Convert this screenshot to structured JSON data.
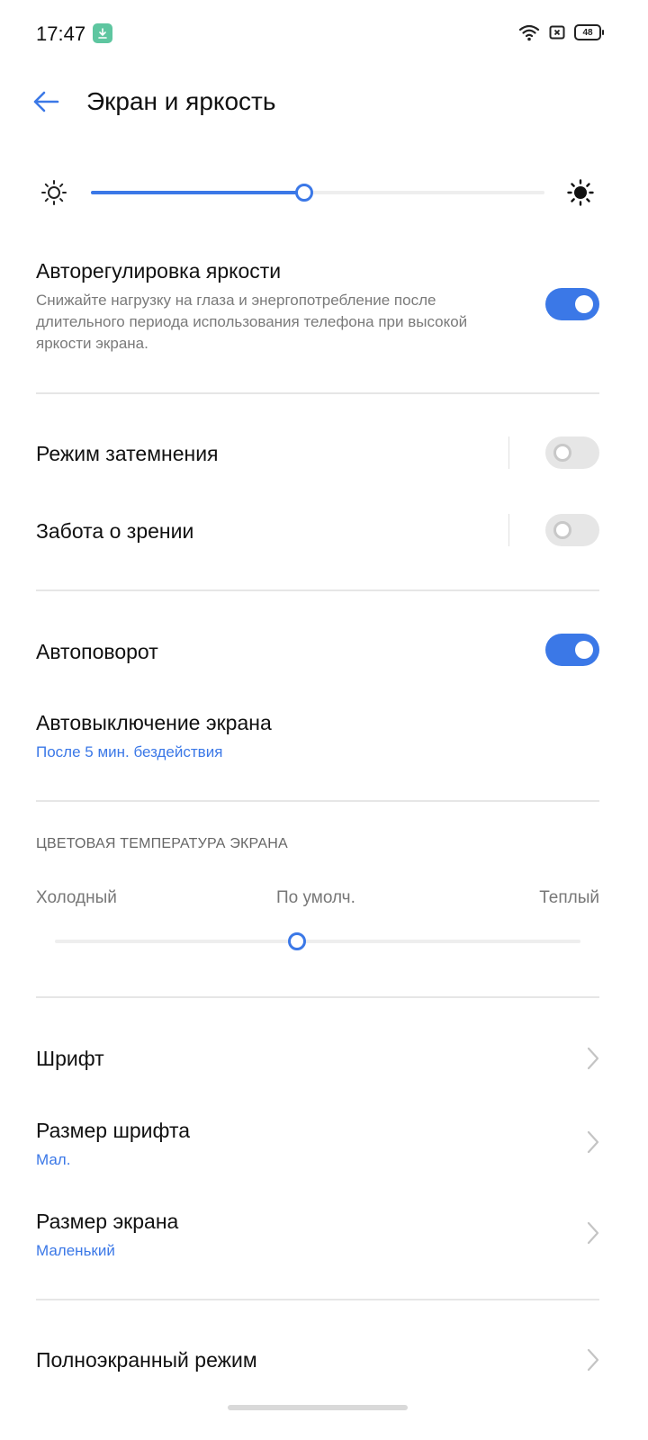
{
  "status_bar": {
    "time": "17:47",
    "battery_level": "48",
    "icons": [
      "download-icon",
      "wifi-icon",
      "screenshot-icon",
      "battery-icon"
    ]
  },
  "header": {
    "title": "Экран и яркость",
    "back_icon": "arrow-left-icon"
  },
  "brightness": {
    "level_percent": 47,
    "min_icon": "sun-outline-icon",
    "max_icon": "sun-filled-icon"
  },
  "auto_brightness": {
    "title": "Авторегулировка яркости",
    "description": "Снижайте нагрузку на глаза и энергопотребление после длительного периода использования телефона при высокой яркости экрана.",
    "enabled": true
  },
  "dark_mode": {
    "title": "Режим затемнения",
    "enabled": false
  },
  "eye_care": {
    "title": "Забота о зрении",
    "enabled": false
  },
  "auto_rotate": {
    "title": "Автоповорот",
    "enabled": true
  },
  "screen_timeout": {
    "title": "Автовыключение экрана",
    "value": "После 5 мин. бездействия"
  },
  "color_temperature": {
    "caption": "ЦВЕТОВАЯ ТЕМПЕРАТУРА ЭКРАНА",
    "cold_label": "Холодный",
    "default_label": "По умолч.",
    "warm_label": "Теплый",
    "level_percent": 46
  },
  "font": {
    "title": "Шрифт"
  },
  "font_size": {
    "title": "Размер шрифта",
    "value": "Мал."
  },
  "display_size": {
    "title": "Размер экрана",
    "value": "Маленький"
  },
  "fullscreen": {
    "title": "Полноэкранный режим"
  },
  "colors": {
    "accent": "#3b78e7",
    "divider": "#e6e6e6",
    "toggle_off": "#e6e6e6",
    "download_badge": "#5ec6a0"
  }
}
